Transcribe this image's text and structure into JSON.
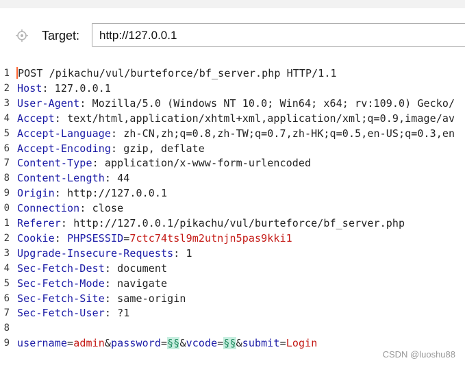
{
  "target": {
    "label": "Target:",
    "url": "http://127.0.0.1"
  },
  "request": {
    "request_line": "POST /pikachu/vul/burteforce/bf_server.php HTTP/1.1",
    "headers": [
      {
        "ln": "2",
        "name": "Host",
        "value": "127.0.0.1"
      },
      {
        "ln": "3",
        "name": "User-Agent",
        "value": "Mozilla/5.0 (Windows NT 10.0; Win64; x64; rv:109.0) Gecko/"
      },
      {
        "ln": "4",
        "name": "Accept",
        "value": "text/html,application/xhtml+xml,application/xml;q=0.9,image/av"
      },
      {
        "ln": "5",
        "name": "Accept-Language",
        "value": "zh-CN,zh;q=0.8,zh-TW;q=0.7,zh-HK;q=0.5,en-US;q=0.3,en"
      },
      {
        "ln": "6",
        "name": "Accept-Encoding",
        "value": "gzip, deflate"
      },
      {
        "ln": "7",
        "name": "Content-Type",
        "value": "application/x-www-form-urlencoded"
      },
      {
        "ln": "8",
        "name": "Content-Length",
        "value": "44"
      },
      {
        "ln": "9",
        "name": "Origin",
        "value": "http://127.0.0.1"
      },
      {
        "ln": "0",
        "name": "Connection",
        "value": "close"
      },
      {
        "ln": "1",
        "name": "Referer",
        "value": "http://127.0.0.1/pikachu/vul/burteforce/bf_server.php"
      }
    ],
    "cookie": {
      "ln": "2",
      "name": "Cookie",
      "cookie_name": "PHPSESSID",
      "cookie_value": "7ctc74tsl9m2utnjn5pas9kki1"
    },
    "headers_after": [
      {
        "ln": "3",
        "name": "Upgrade-Insecure-Requests",
        "value": "1"
      },
      {
        "ln": "4",
        "name": "Sec-Fetch-Dest",
        "value": "document"
      },
      {
        "ln": "5",
        "name": "Sec-Fetch-Mode",
        "value": "navigate"
      },
      {
        "ln": "6",
        "name": "Sec-Fetch-Site",
        "value": "same-origin"
      },
      {
        "ln": "7",
        "name": "Sec-Fetch-User",
        "value": "?1"
      }
    ],
    "blank_ln": "8",
    "body_ln": "9",
    "body": [
      {
        "key": "username",
        "value": "admin",
        "marked": false
      },
      {
        "key": "password",
        "value": "§§",
        "marked": true
      },
      {
        "key": "vcode",
        "value": "§§",
        "marked": true
      },
      {
        "key": "submit",
        "value": "Login",
        "marked": false
      }
    ],
    "first_ln": "1"
  },
  "watermark": "CSDN @luoshu88",
  "colors": {
    "header_name": "#1a1aa6",
    "param_value": "#c41a16",
    "payload_marker_bg": "#c8eee0",
    "cursor": "#ff6633"
  }
}
